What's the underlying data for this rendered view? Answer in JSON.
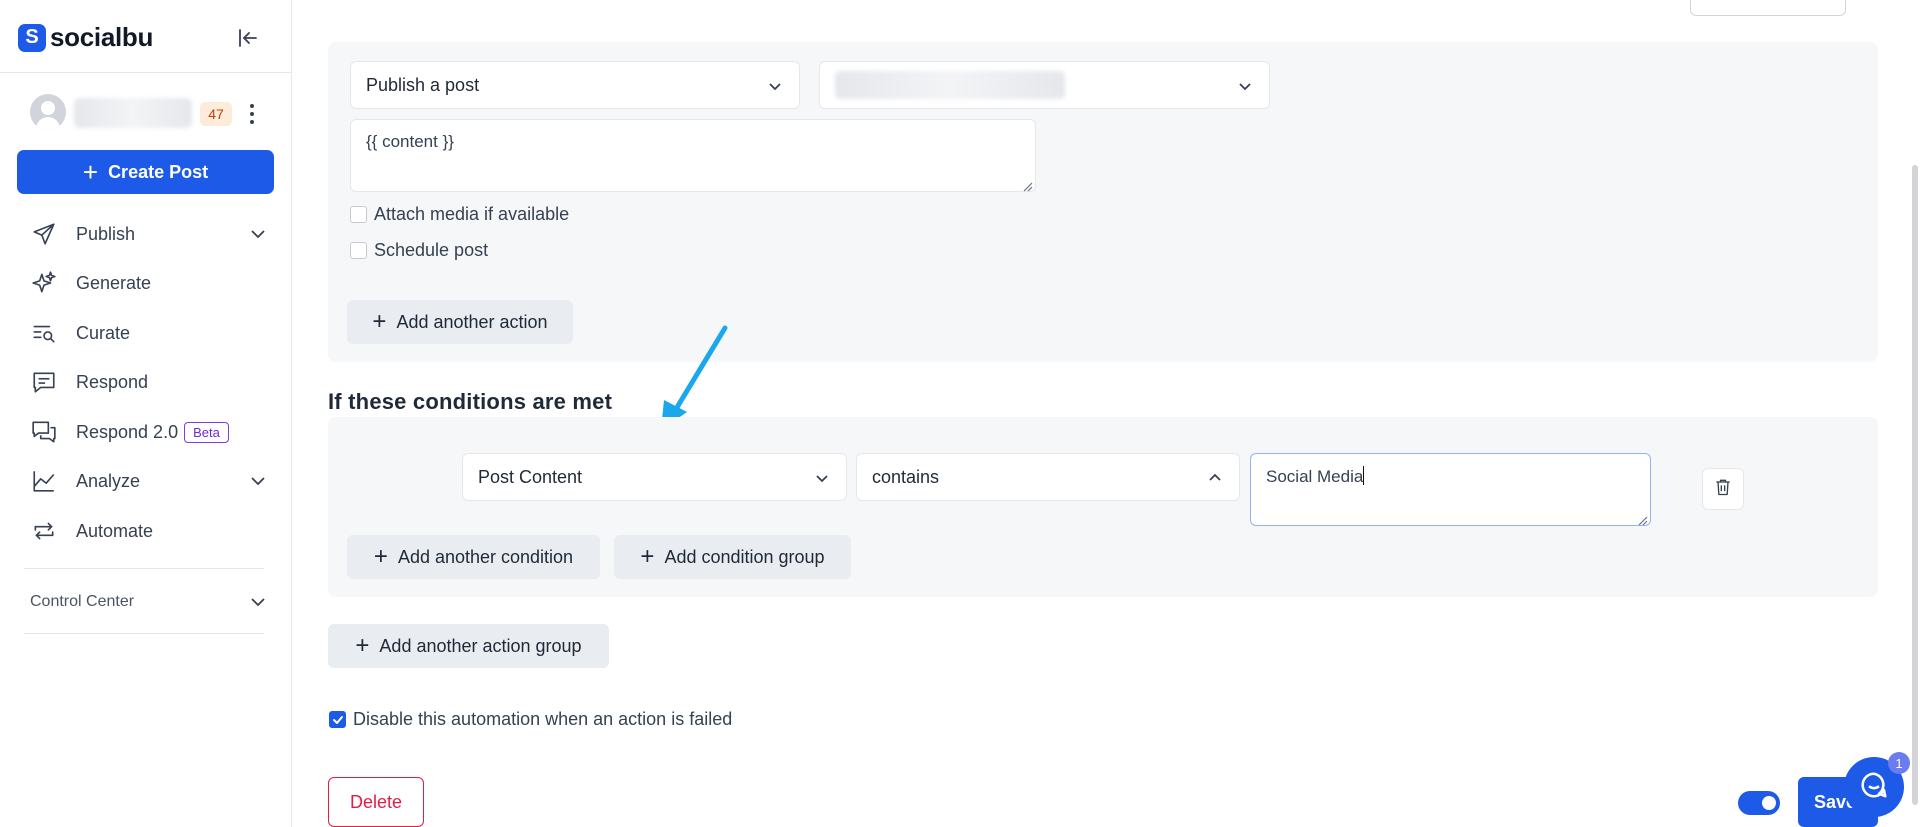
{
  "sidebar": {
    "brand": "socialbu",
    "notification_count": "47",
    "create_post_label": "Create Post",
    "nav": {
      "publish": "Publish",
      "generate": "Generate",
      "curate": "Curate",
      "respond": "Respond",
      "respond2": "Respond 2.0",
      "respond2_badge": "Beta",
      "analyze": "Analyze",
      "automate": "Automate"
    },
    "control_center": "Control Center"
  },
  "main": {
    "action": {
      "type_value": "Publish a post",
      "content_value": "{{ content }}",
      "attach_media_label": "Attach media if available",
      "attach_media_checked": false,
      "schedule_label": "Schedule post",
      "schedule_checked": false,
      "add_action_label": "Add another action"
    },
    "conditions": {
      "title": "If these conditions are met",
      "field_value": "Post Content",
      "operator_value": "contains",
      "text_value": "Social Media",
      "add_condition_label": "Add another condition",
      "add_group_label": "Add condition group"
    },
    "add_action_group_label": "Add another action group",
    "disable_on_fail_label": "Disable this automation when an action is failed",
    "disable_on_fail_checked": true,
    "delete_label": "Delete",
    "save_label": "Save",
    "chat_unread": "1"
  },
  "colors": {
    "accent": "#1e5ae8",
    "danger": "#e11d48",
    "annotation_arrow": "#1aa7ec",
    "panel_bg": "#f6f7f9"
  }
}
